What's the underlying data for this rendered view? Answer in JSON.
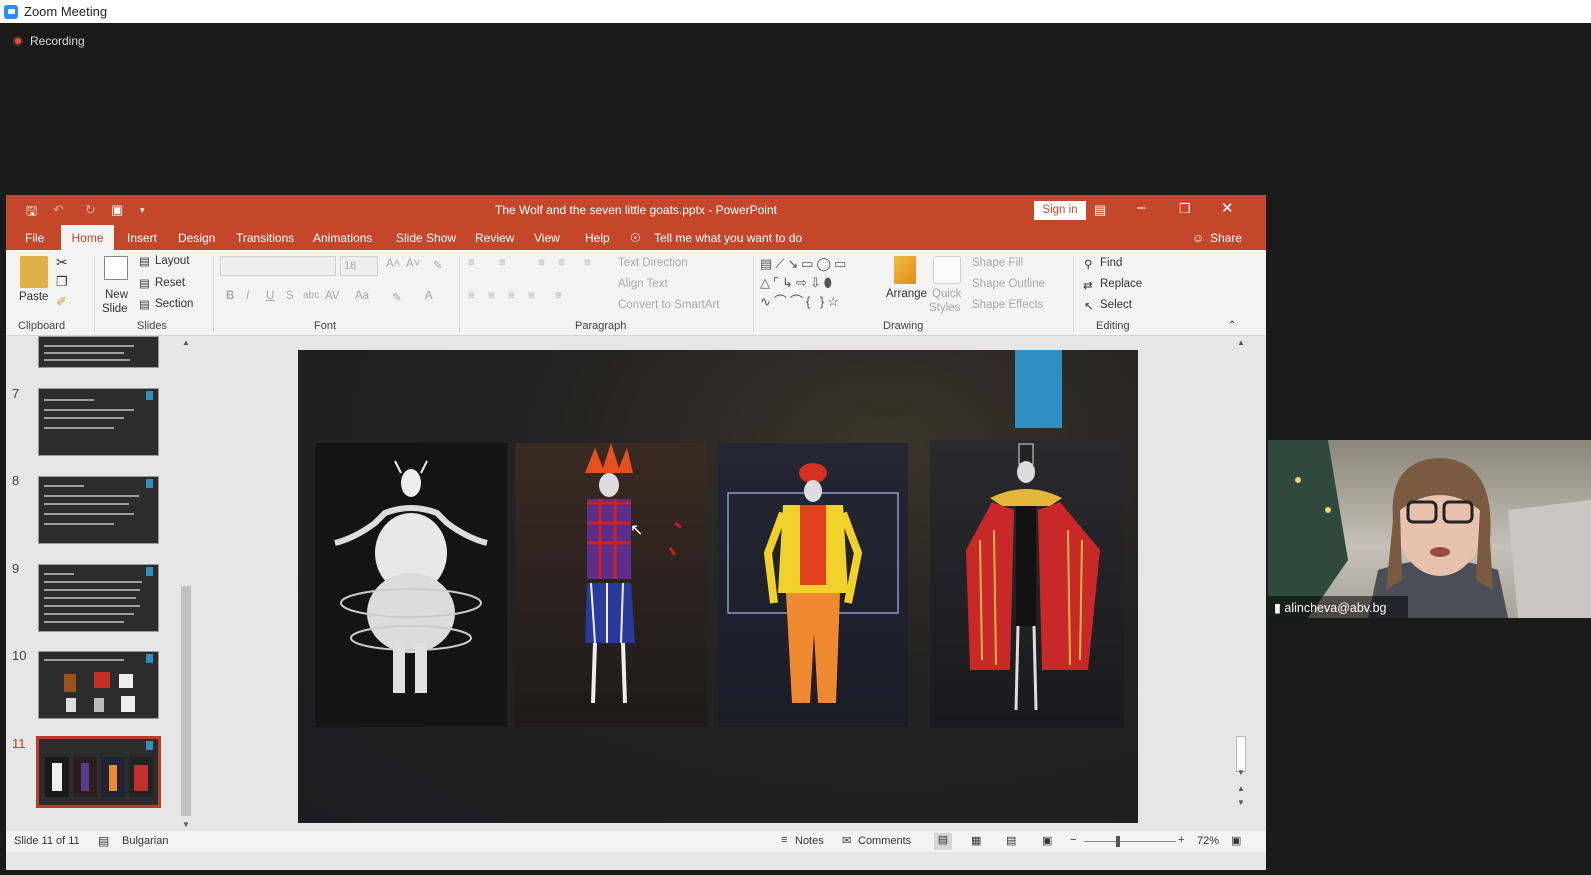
{
  "zoom": {
    "window_title": "Zoom Meeting",
    "recording_label": "Recording"
  },
  "powerpoint": {
    "window_title": "The Wolf and the seven little goats.pptx  -  PowerPoint",
    "sign_in": "Sign in",
    "tabs": [
      "File",
      "Home",
      "Insert",
      "Design",
      "Transitions",
      "Animations",
      "Slide Show",
      "Review",
      "View",
      "Help"
    ],
    "tell_me": "Tell me what you want to do",
    "share": "Share",
    "ribbon": {
      "clipboard": {
        "paste": "Paste",
        "group": "Clipboard"
      },
      "slides": {
        "new_slide": "New",
        "new_slide_2": "Slide",
        "layout": "Layout",
        "reset": "Reset",
        "section": "Section",
        "group": "Slides"
      },
      "font": {
        "size": "18",
        "group": "Font"
      },
      "paragraph": {
        "text_direction": "Text Direction",
        "align_text": "Align Text",
        "convert": "Convert to SmartArt",
        "group": "Paragraph"
      },
      "drawing": {
        "arrange": "Arrange",
        "quick": "Quick",
        "styles": "Styles",
        "shape_fill": "Shape Fill",
        "shape_outline": "Shape Outline",
        "shape_effects": "Shape Effects",
        "group": "Drawing"
      },
      "editing": {
        "find": "Find",
        "replace": "Replace",
        "select": "Select",
        "group": "Editing"
      }
    },
    "slide_numbers": [
      "7",
      "8",
      "9",
      "10",
      "11"
    ],
    "status": {
      "slide_info": "Slide 11 of 11",
      "language": "Bulgarian",
      "notes": "Notes",
      "comments": "Comments",
      "zoom": "72%"
    }
  },
  "video": {
    "participant": "alincheva@abv.bg"
  },
  "colors": {
    "ppt_accent": "#c5472b",
    "slide_blue": "#2f8fc2",
    "selected_slide": "#c0392b"
  }
}
